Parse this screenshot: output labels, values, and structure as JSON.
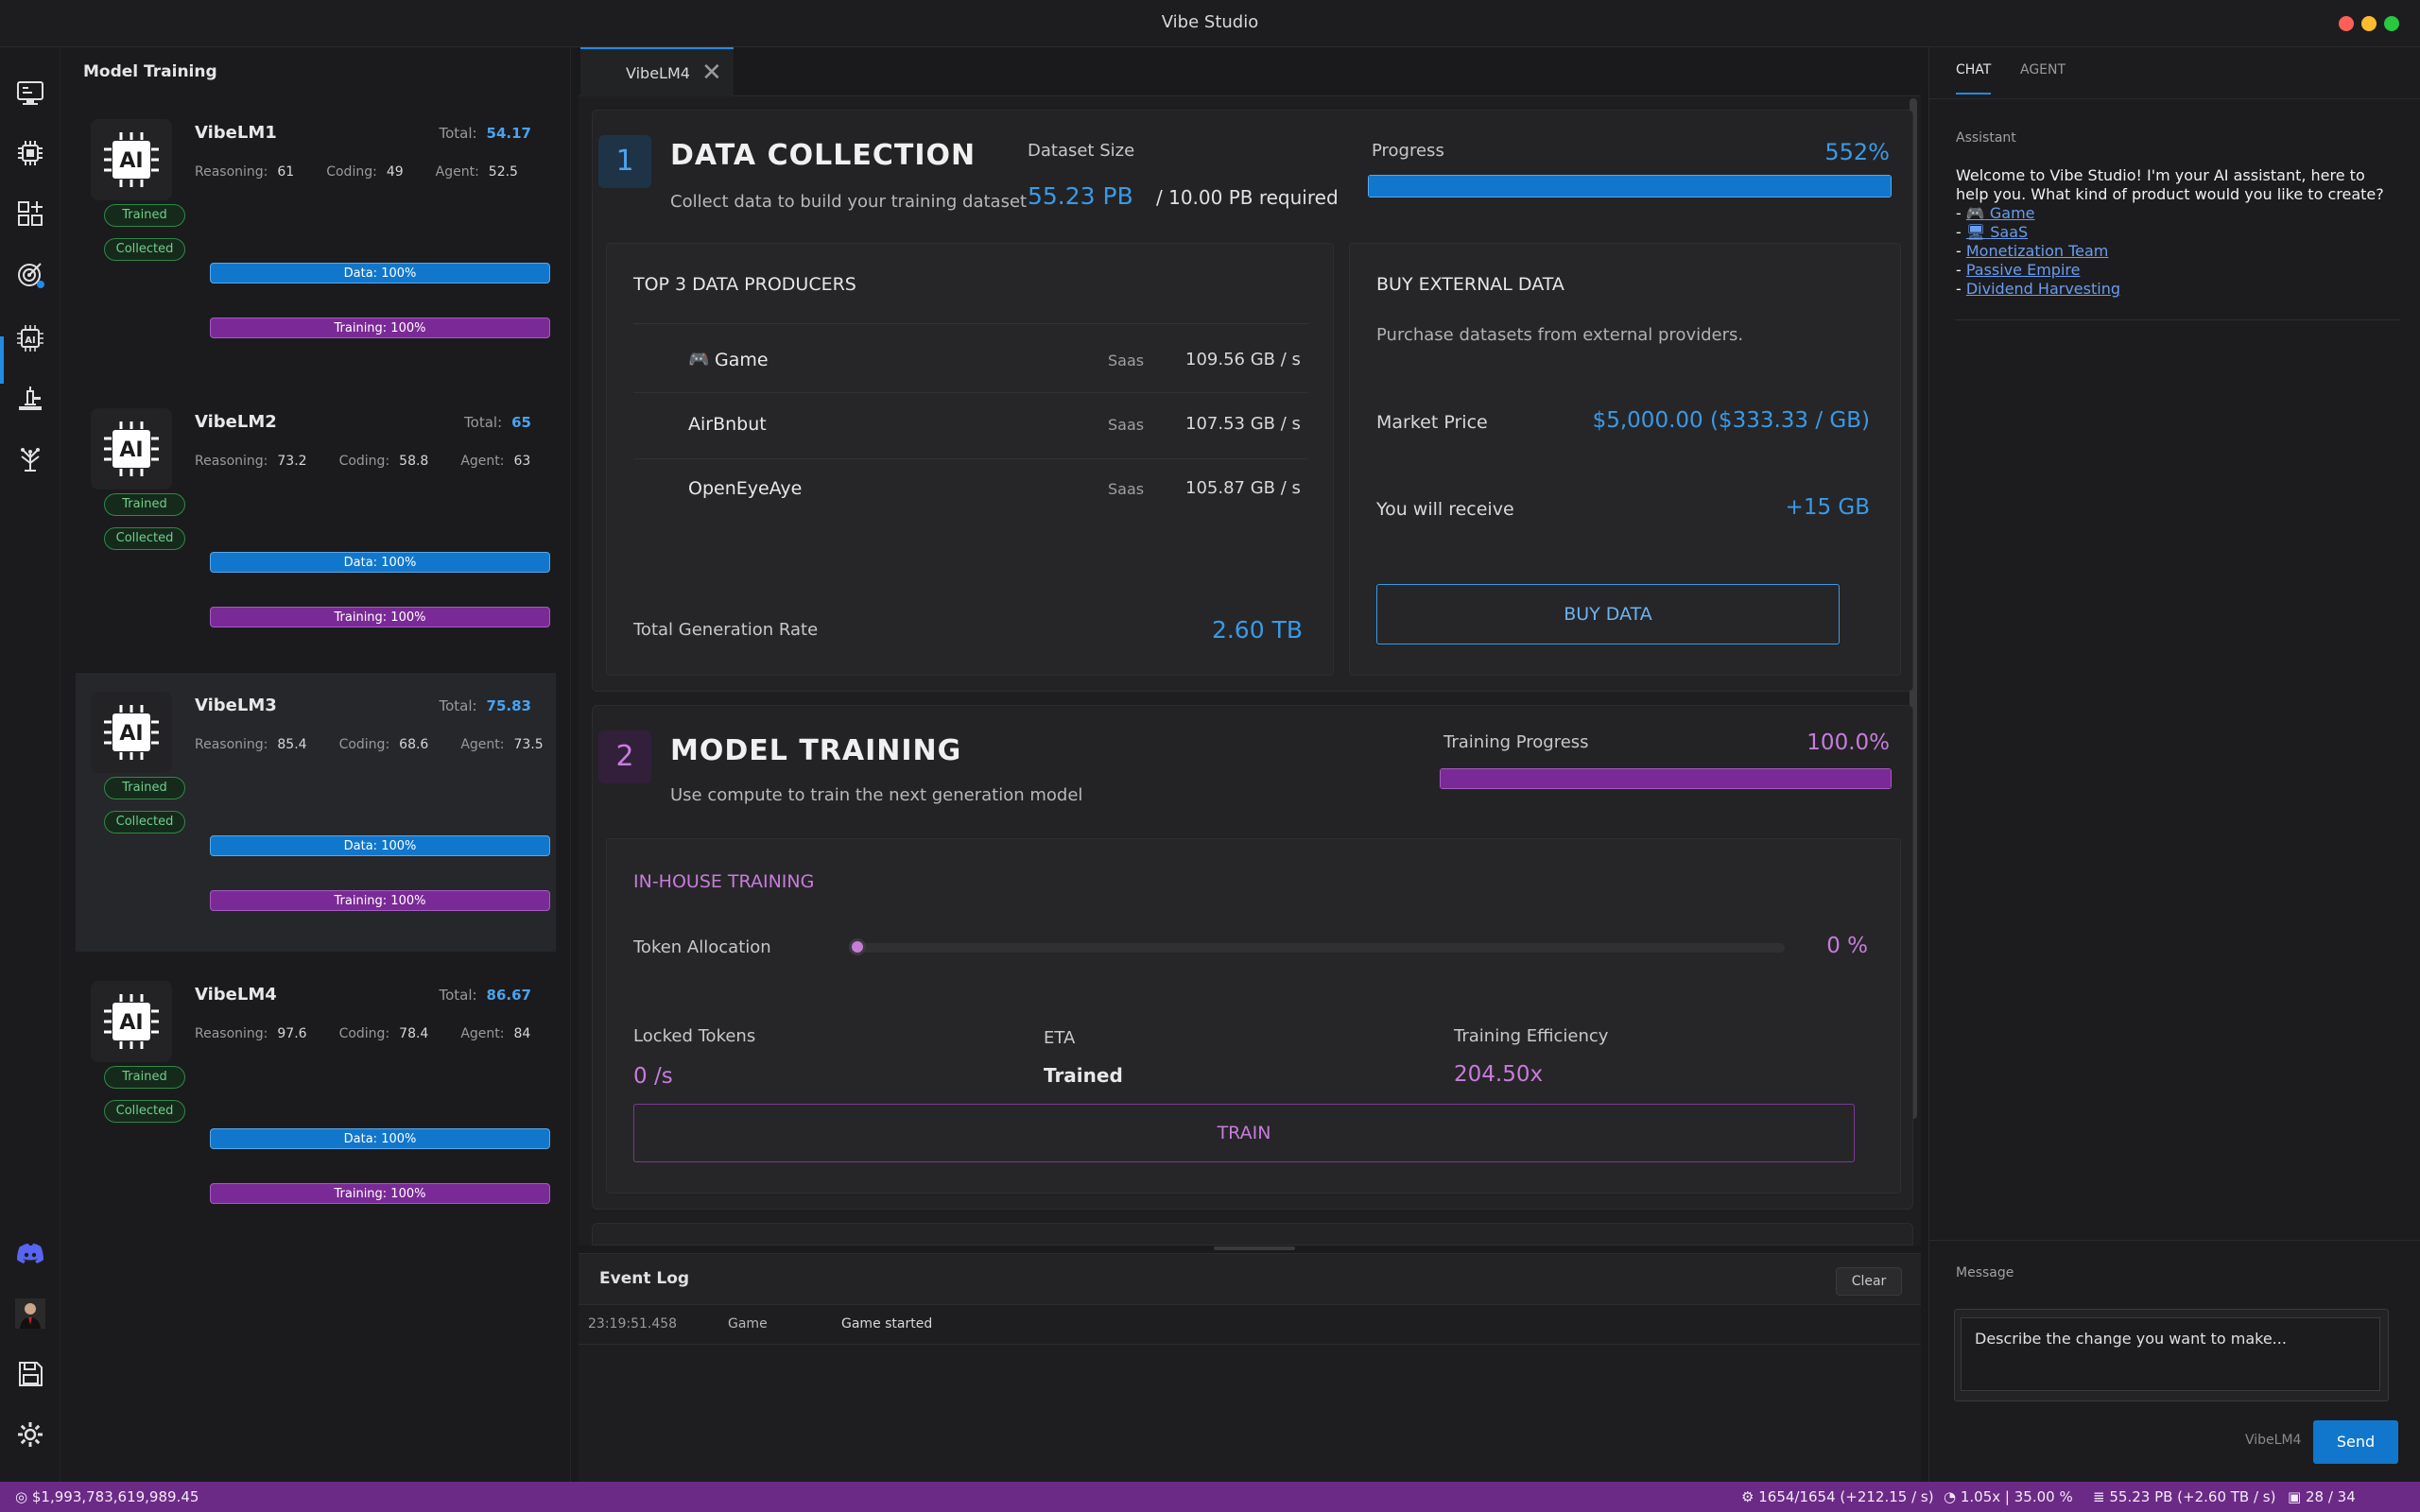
{
  "window": {
    "title": "Vibe Studio"
  },
  "models_panel": {
    "title": "Model Training",
    "models": [
      {
        "name": "VibeLM1",
        "total_label": "Total:",
        "total": "54.17",
        "reasoning_label": "Reasoning:",
        "reasoning": "61",
        "coding_label": "Coding:",
        "coding": "49",
        "agent_label": "Agent:",
        "agent": "52.5",
        "badge_trained": "Trained",
        "badge_collected": "Collected",
        "data_bar": "Data: 100%",
        "training_bar": "Training: 100%",
        "data_progress": 1.0,
        "training_progress": 1.0
      },
      {
        "name": "VibeLM2",
        "total_label": "Total:",
        "total": "65",
        "reasoning_label": "Reasoning:",
        "reasoning": "73.2",
        "coding_label": "Coding:",
        "coding": "58.8",
        "agent_label": "Agent:",
        "agent": "63",
        "badge_trained": "Trained",
        "badge_collected": "Collected",
        "data_bar": "Data: 100%",
        "training_bar": "Training: 100%",
        "data_progress": 1.0,
        "training_progress": 1.0
      },
      {
        "name": "VibeLM3",
        "total_label": "Total:",
        "total": "75.83",
        "reasoning_label": "Reasoning:",
        "reasoning": "85.4",
        "coding_label": "Coding:",
        "coding": "68.6",
        "agent_label": "Agent:",
        "agent": "73.5",
        "badge_trained": "Trained",
        "badge_collected": "Collected",
        "data_bar": "Data: 100%",
        "training_bar": "Training: 100%",
        "data_progress": 1.0,
        "training_progress": 1.0
      },
      {
        "name": "VibeLM4",
        "total_label": "Total:",
        "total": "86.67",
        "reasoning_label": "Reasoning:",
        "reasoning": "97.6",
        "coding_label": "Coding:",
        "coding": "78.4",
        "agent_label": "Agent:",
        "agent": "84",
        "badge_trained": "Trained",
        "badge_collected": "Collected",
        "data_bar": "Data: 100%",
        "training_bar": "Training: 100%",
        "data_progress": 1.0,
        "training_progress": 1.0
      }
    ],
    "chip_text": "AI"
  },
  "tabs": [
    {
      "label": "VibeLM4"
    }
  ],
  "data_collection": {
    "step": "1",
    "title": "DATA COLLECTION",
    "subtitle": "Collect data to build your training dataset",
    "dataset_size_label": "Dataset Size",
    "dataset_size_value": "55.23 PB",
    "dataset_required": "/ 10.00 PB required",
    "progress_label": "Progress",
    "progress_value": "552%",
    "progress_fraction": 1.0,
    "producers": {
      "title": "TOP 3 DATA PRODUCERS",
      "items": [
        {
          "icon": "🎮",
          "name": "Game",
          "type": "Saas",
          "rate": "109.56 GB / s"
        },
        {
          "icon": "",
          "name": "AirBnbut",
          "type": "Saas",
          "rate": "107.53 GB / s"
        },
        {
          "icon": "",
          "name": "OpenEyeAye",
          "type": "Saas",
          "rate": "105.87 GB / s"
        }
      ],
      "total_label": "Total Generation Rate",
      "total_value": "2.60 TB"
    },
    "buy": {
      "title": "BUY EXTERNAL DATA",
      "desc": "Purchase datasets from external providers.",
      "market_label": "Market Price",
      "market_value": "$5,000.00 ($333.33 / GB)",
      "receive_label": "You will receive",
      "receive_value": "+15 GB",
      "button": "BUY DATA"
    }
  },
  "model_training": {
    "step": "2",
    "title": "MODEL TRAINING",
    "subtitle": "Use compute to train the next generation model",
    "progress_label": "Training Progress",
    "progress_value": "100.0%",
    "progress_fraction": 1.0,
    "inhouse": {
      "title": "IN-HOUSE TRAINING",
      "token_label": "Token Allocation",
      "token_value": "0 %",
      "slider_fraction": 0.0,
      "locked_label": "Locked Tokens",
      "locked_value": "0 /s",
      "eta_label": "ETA",
      "eta_value": "Trained",
      "eff_label": "Training Efficiency",
      "eff_value": "204.50x",
      "button": "TRAIN"
    }
  },
  "event_log": {
    "title": "Event Log",
    "clear": "Clear",
    "rows": [
      {
        "time": "23:19:51.458",
        "source": "Game",
        "message": "Game started"
      }
    ]
  },
  "chat": {
    "tab_chat": "CHAT",
    "tab_agent": "AGENT",
    "assistant_label": "Assistant",
    "welcome": "Welcome to Vibe Studio! I'm your AI assistant, here to help you. What kind of product would you like to create?",
    "options": [
      {
        "icon": "🎮",
        "label": "Game"
      },
      {
        "icon": "🖥",
        "label": "SaaS"
      },
      {
        "icon": "",
        "label": "Monetization Team"
      },
      {
        "icon": "",
        "label": "Passive Empire"
      },
      {
        "icon": "",
        "label": "Dividend Harvesting"
      }
    ],
    "message_label": "Message",
    "message_placeholder": "Describe the change you want to make...",
    "context": "VibeLM4",
    "send": "Send"
  },
  "status_bar": {
    "money": "$1,993,783,619,989.45",
    "tokens": "1654/1654 (+212.15 / s)",
    "speed": "1.05x | 35.00 %",
    "data": "55.23 PB (+2.60 TB / s)",
    "count": "28 / 34"
  },
  "colors": {
    "accent_blue": "#1f8ce6",
    "accent_purple": "#c77cdb",
    "status_bar": "#6b2a86",
    "trained_green": "#6fd08b"
  }
}
